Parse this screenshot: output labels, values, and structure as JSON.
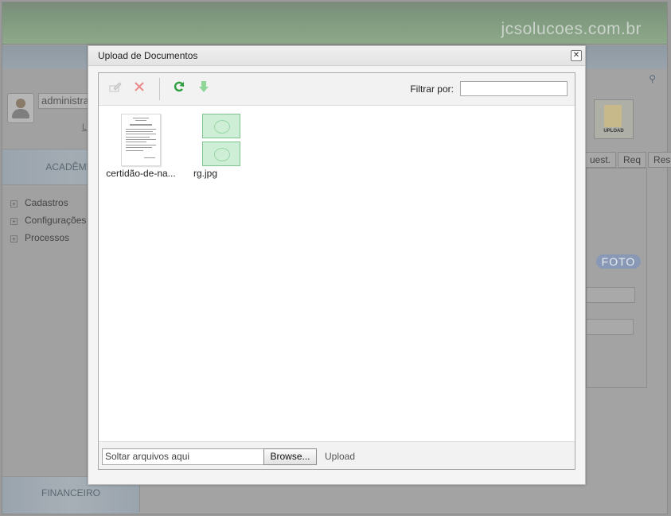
{
  "app": {
    "brand": "jcsolucoes.com.br",
    "user_name": "administra",
    "user_link": "L",
    "menu": {
      "section_academico": "ACADÊMIC",
      "items": [
        {
          "label": "Cadastros"
        },
        {
          "label": "Configurações"
        },
        {
          "label": "Processos"
        }
      ],
      "section_financeiro": "FINANCEIRO"
    },
    "tabs": [
      "uest.",
      "Req",
      "Respo"
    ],
    "foto_label": "FOTO",
    "upload_button_label": "UPLOAD"
  },
  "dialog": {
    "title": "Upload de Documentos",
    "close_glyph": "✕",
    "toolbar": {
      "rename_icon": "edit-icon",
      "delete_icon": "delete-icon",
      "refresh_icon": "refresh-icon",
      "download_icon": "download-icon",
      "filter_label": "Filtrar por:",
      "filter_value": ""
    },
    "files": [
      {
        "name": "certidão-de-na...",
        "type": "document"
      },
      {
        "name": "rg.jpg",
        "type": "image"
      }
    ],
    "footer": {
      "drop_placeholder": "Soltar arquivos aqui",
      "browse_label": "Browse...",
      "upload_label": "Upload"
    },
    "colors": {
      "delete": "#e26a6a",
      "refresh": "#2e9e3e",
      "download": "#7fd08a",
      "rg_card": "#cfeed6"
    }
  }
}
